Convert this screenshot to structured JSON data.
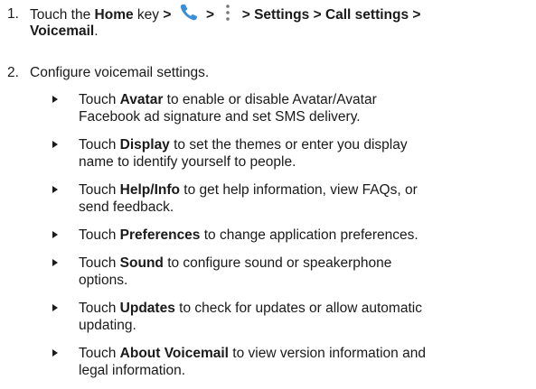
{
  "step1": {
    "number": "1.",
    "text_touch": "Touch the ",
    "home_key": "Home",
    "text_key": " key ",
    "sep1": ">",
    "sep2": ">",
    "sep3": ">",
    "settings": "Settings",
    "sep4": ">",
    "call_settings": "Call settings",
    "sep5": ">",
    "voicemail": "Voicemail",
    "period": ".",
    "phone_icon": "phone-icon",
    "menu_icon": "more-vertical-icon"
  },
  "step2": {
    "number": "2.",
    "text": "Configure voicemail settings."
  },
  "bullets": [
    {
      "pre": "Touch ",
      "bold": "Avatar",
      "post": " to enable or disable Avatar/Avatar",
      "line2": "Facebook ad signature and set SMS delivery."
    },
    {
      "pre": "Touch ",
      "bold": "Display",
      "post": " to set the themes or enter you display",
      "line2": "name to identify yourself to people."
    },
    {
      "pre": "Touch ",
      "bold": "Help/Info",
      "post": " to get help information, view FAQs, or",
      "line2": "send feedback."
    },
    {
      "pre": "Touch ",
      "bold": "Preferences",
      "post": " to change application preferences.",
      "line2": ""
    },
    {
      "pre": "Touch ",
      "bold": "Sound",
      "post": " to configure sound or speakerphone",
      "line2": "options."
    },
    {
      "pre": "Touch ",
      "bold": "Updates",
      "post": " to check for updates or allow automatic",
      "line2": "updating."
    },
    {
      "pre": "Touch ",
      "bold": "About Voicemail",
      "post": " to view version information and",
      "line2": "legal information."
    }
  ],
  "colors": {
    "phone_icon": "#3a8fd6",
    "text": "#1a1a1a"
  }
}
